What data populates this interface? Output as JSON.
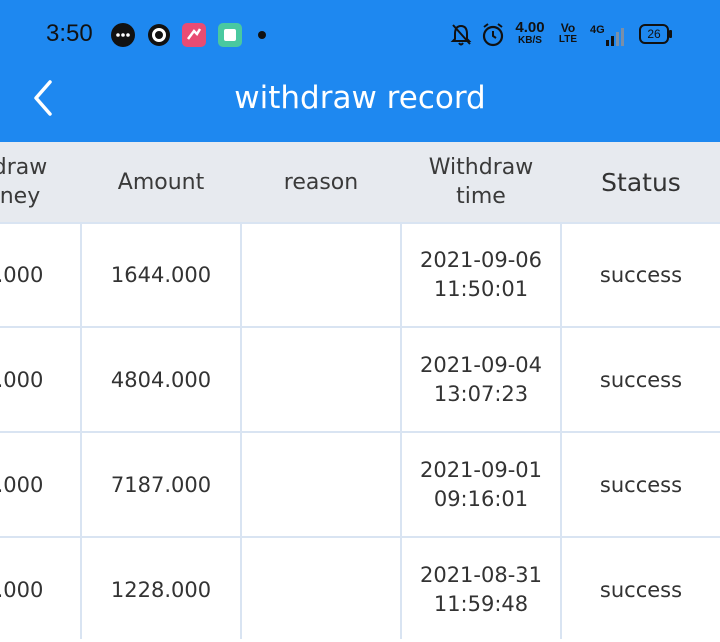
{
  "status_bar": {
    "time": "3:50",
    "net_speed": "4.00",
    "net_unit": "KB/S",
    "volte": "Vo",
    "lte": "LTE",
    "network": "4G",
    "battery": "26"
  },
  "header": {
    "title": "withdraw record",
    "colors": {
      "bar": "#1e88f0",
      "table_header": "#e7eaef"
    }
  },
  "table": {
    "columns": {
      "money_line1": "draw",
      "money_line2": "ney",
      "amount": "Amount",
      "reason": "reason",
      "time_line1": "Withdraw",
      "time_line2": "time",
      "status": "Status"
    },
    "rows": [
      {
        "money": ".000",
        "amount": "1644.000",
        "reason": "",
        "date": "2021-09-06",
        "clock": "11:50:01",
        "status": "success"
      },
      {
        "money": ".000",
        "amount": "4804.000",
        "reason": "",
        "date": "2021-09-04",
        "clock": "13:07:23",
        "status": "success"
      },
      {
        "money": ".000",
        "amount": "7187.000",
        "reason": "",
        "date": "2021-09-01",
        "clock": "09:16:01",
        "status": "success"
      },
      {
        "money": ".000",
        "amount": "1228.000",
        "reason": "",
        "date": "2021-08-31",
        "clock": "11:59:48",
        "status": "success"
      }
    ]
  }
}
